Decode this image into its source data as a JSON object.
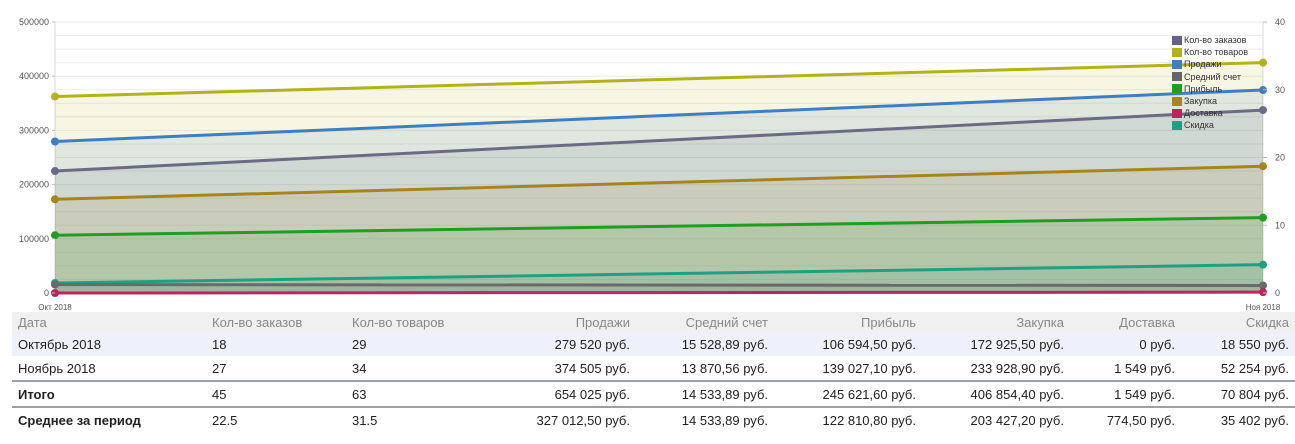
{
  "chart_data": {
    "type": "area",
    "x": [
      "Окт 2018",
      "Ноя 2018"
    ],
    "y_left_ticks": [
      "0",
      "100000",
      "200000",
      "300000",
      "400000",
      "500000"
    ],
    "y_right_ticks": [
      "0",
      "10",
      "20",
      "30",
      "40"
    ],
    "ylim_left": [
      0,
      500000
    ],
    "ylim_right": [
      0,
      40
    ],
    "grid": true,
    "legend_position": "top-right",
    "series": [
      {
        "name": "Кол-во товаров",
        "axis": "right",
        "values": [
          29,
          34
        ],
        "color": "#b2b21a"
      },
      {
        "name": "Продажи",
        "axis": "left",
        "values": [
          279520,
          374505
        ],
        "color": "#3d7fc4"
      },
      {
        "name": "Кол-во заказов",
        "axis": "right",
        "values": [
          18,
          27
        ],
        "color": "#6c6a86"
      },
      {
        "name": "Закупка",
        "axis": "left",
        "values": [
          172925.5,
          233928.9
        ],
        "color": "#a8841c"
      },
      {
        "name": "Прибыль",
        "axis": "left",
        "values": [
          106594.5,
          139027.1
        ],
        "color": "#1f9e1f"
      },
      {
        "name": "Скидка",
        "axis": "left",
        "values": [
          18550,
          52254
        ],
        "color": "#1fa083"
      },
      {
        "name": "Средний счет",
        "axis": "left",
        "values": [
          15528.89,
          13870.56
        ],
        "color": "#6a6a6a"
      },
      {
        "name": "Доставка",
        "axis": "left",
        "values": [
          0,
          1549
        ],
        "color": "#c0245f"
      }
    ],
    "legend": [
      {
        "name": "Кол-во заказов",
        "color": "#66608a"
      },
      {
        "name": "Кол-во товаров",
        "color": "#b2b21a"
      },
      {
        "name": "Продажи",
        "color": "#3d7fc4"
      },
      {
        "name": "Средний счет",
        "color": "#666666"
      },
      {
        "name": "Прибыль",
        "color": "#1f9e1f"
      },
      {
        "name": "Закупка",
        "color": "#a8841c"
      },
      {
        "name": "Доставка",
        "color": "#c0245f"
      },
      {
        "name": "Скидка",
        "color": "#1fa083"
      }
    ]
  },
  "table": {
    "headers": [
      "Дата",
      "Кол-во заказов",
      "Кол-во товаров",
      "Продажи",
      "Средний счет",
      "Прибыль",
      "Закупка",
      "Доставка",
      "Скидка"
    ],
    "rows": [
      [
        "Октябрь 2018",
        "18",
        "29",
        "279 520 руб.",
        "15 528,89 руб.",
        "106 594,50 руб.",
        "172 925,50 руб.",
        "0 руб.",
        "18 550 руб."
      ],
      [
        "Ноябрь 2018",
        "27",
        "34",
        "374 505 руб.",
        "13 870,56 руб.",
        "139 027,10 руб.",
        "233 928,90 руб.",
        "1 549 руб.",
        "52 254 руб."
      ]
    ],
    "total": [
      "Итого",
      "45",
      "63",
      "654 025 руб.",
      "14 533,89 руб.",
      "245 621,60 руб.",
      "406 854,40 руб.",
      "1 549 руб.",
      "70 804 руб."
    ],
    "average": [
      "Среднее за период",
      "22.5",
      "31.5",
      "327 012,50 руб.",
      "14 533,89 руб.",
      "122 810,80 руб.",
      "203 427,20 руб.",
      "774,50 руб.",
      "35 402 руб."
    ]
  }
}
